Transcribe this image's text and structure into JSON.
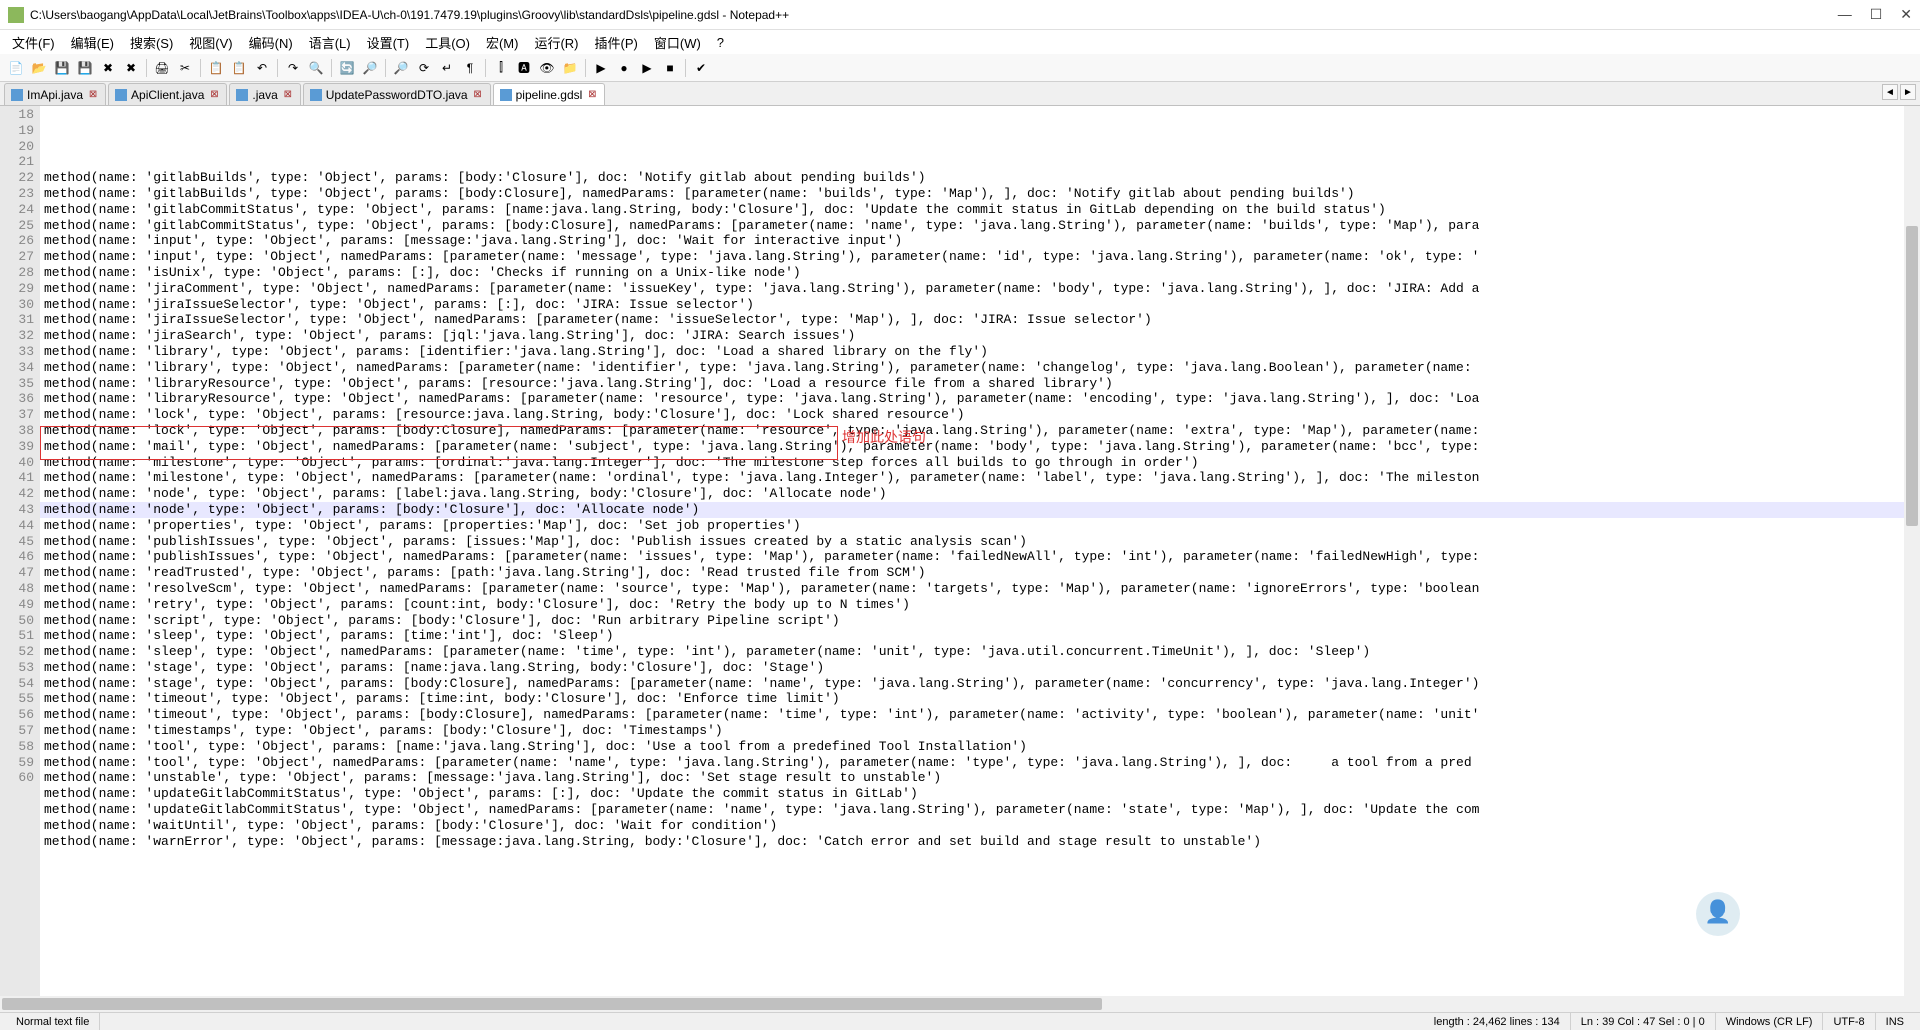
{
  "window": {
    "title": "C:\\Users\\baogang\\AppData\\Local\\JetBrains\\Toolbox\\apps\\IDEA-U\\ch-0\\191.7479.19\\plugins\\Groovy\\lib\\standardDsls\\pipeline.gdsl - Notepad++"
  },
  "menu": {
    "items": [
      "文件(F)",
      "编辑(E)",
      "搜索(S)",
      "视图(V)",
      "编码(N)",
      "语言(L)",
      "设置(T)",
      "工具(O)",
      "宏(M)",
      "运行(R)",
      "插件(P)",
      "窗口(W)",
      "?"
    ]
  },
  "toolbar": {
    "icons": [
      "new",
      "open",
      "save",
      "save-all",
      "close",
      "close-all",
      "print",
      "cut",
      "copy",
      "paste",
      "undo",
      "redo",
      "find",
      "replace",
      "zoom-in",
      "zoom-out",
      "sync",
      "wrap",
      "show-all",
      "indent-guide",
      "lang",
      "eye",
      "folder",
      "run",
      "rec",
      "play",
      "stop",
      "spellcheck"
    ]
  },
  "tabs": {
    "items": [
      {
        "label": "ImApi.java",
        "active": false
      },
      {
        "label": "ApiClient.java",
        "active": false
      },
      {
        "label": ".java",
        "active": false
      },
      {
        "label": "UpdatePasswordDTO.java",
        "active": false
      },
      {
        "label": "pipeline.gdsl",
        "active": true
      }
    ]
  },
  "editor": {
    "first_line": 18,
    "highlighted_line": 39,
    "lines": [
      "method(name: 'gitlabBuilds', type: 'Object', params: [body:'Closure'], doc: 'Notify gitlab about pending builds')",
      "method(name: 'gitlabBuilds', type: 'Object', params: [body:Closure], namedParams: [parameter(name: 'builds', type: 'Map'), ], doc: 'Notify gitlab about pending builds')",
      "method(name: 'gitlabCommitStatus', type: 'Object', params: [name:java.lang.String, body:'Closure'], doc: 'Update the commit status in GitLab depending on the build status')",
      "method(name: 'gitlabCommitStatus', type: 'Object', params: [body:Closure], namedParams: [parameter(name: 'name', type: 'java.lang.String'), parameter(name: 'builds', type: 'Map'), para",
      "method(name: 'input', type: 'Object', params: [message:'java.lang.String'], doc: 'Wait for interactive input')",
      "method(name: 'input', type: 'Object', namedParams: [parameter(name: 'message', type: 'java.lang.String'), parameter(name: 'id', type: 'java.lang.String'), parameter(name: 'ok', type: '",
      "method(name: 'isUnix', type: 'Object', params: [:], doc: 'Checks if running on a Unix-like node')",
      "method(name: 'jiraComment', type: 'Object', namedParams: [parameter(name: 'issueKey', type: 'java.lang.String'), parameter(name: 'body', type: 'java.lang.String'), ], doc: 'JIRA: Add a",
      "method(name: 'jiraIssueSelector', type: 'Object', params: [:], doc: 'JIRA: Issue selector')",
      "method(name: 'jiraIssueSelector', type: 'Object', namedParams: [parameter(name: 'issueSelector', type: 'Map'), ], doc: 'JIRA: Issue selector')",
      "method(name: 'jiraSearch', type: 'Object', params: [jql:'java.lang.String'], doc: 'JIRA: Search issues')",
      "method(name: 'library', type: 'Object', params: [identifier:'java.lang.String'], doc: 'Load a shared library on the fly')",
      "method(name: 'library', type: 'Object', namedParams: [parameter(name: 'identifier', type: 'java.lang.String'), parameter(name: 'changelog', type: 'java.lang.Boolean'), parameter(name:",
      "method(name: 'libraryResource', type: 'Object', params: [resource:'java.lang.String'], doc: 'Load a resource file from a shared library')",
      "method(name: 'libraryResource', type: 'Object', namedParams: [parameter(name: 'resource', type: 'java.lang.String'), parameter(name: 'encoding', type: 'java.lang.String'), ], doc: 'Loa",
      "method(name: 'lock', type: 'Object', params: [resource:java.lang.String, body:'Closure'], doc: 'Lock shared resource')",
      "method(name: 'lock', type: 'Object', params: [body:Closure], namedParams: [parameter(name: 'resource', type: 'java.lang.String'), parameter(name: 'extra', type: 'Map'), parameter(name:",
      "method(name: 'mail', type: 'Object', namedParams: [parameter(name: 'subject', type: 'java.lang.String'), parameter(name: 'body', type: 'java.lang.String'), parameter(name: 'bcc', type:",
      "method(name: 'milestone', type: 'Object', params: [ordinal:'java.lang.Integer'], doc: 'The milestone step forces all builds to go through in order')",
      "method(name: 'milestone', type: 'Object', namedParams: [parameter(name: 'ordinal', type: 'java.lang.Integer'), parameter(name: 'label', type: 'java.lang.String'), ], doc: 'The mileston",
      "method(name: 'node', type: 'Object', params: [label:java.lang.String, body:'Closure'], doc: 'Allocate node')",
      "method(name: 'node', type: 'Object', params: [body:'Closure'], doc: 'Allocate node')",
      "method(name: 'properties', type: 'Object', params: [properties:'Map'], doc: 'Set job properties')",
      "method(name: 'publishIssues', type: 'Object', params: [issues:'Map'], doc: 'Publish issues created by a static analysis scan')",
      "method(name: 'publishIssues', type: 'Object', namedParams: [parameter(name: 'issues', type: 'Map'), parameter(name: 'failedNewAll', type: 'int'), parameter(name: 'failedNewHigh', type:",
      "method(name: 'readTrusted', type: 'Object', params: [path:'java.lang.String'], doc: 'Read trusted file from SCM')",
      "method(name: 'resolveScm', type: 'Object', namedParams: [parameter(name: 'source', type: 'Map'), parameter(name: 'targets', type: 'Map'), parameter(name: 'ignoreErrors', type: 'boolean",
      "method(name: 'retry', type: 'Object', params: [count:int, body:'Closure'], doc: 'Retry the body up to N times')",
      "method(name: 'script', type: 'Object', params: [body:'Closure'], doc: 'Run arbitrary Pipeline script')",
      "method(name: 'sleep', type: 'Object', params: [time:'int'], doc: 'Sleep')",
      "method(name: 'sleep', type: 'Object', namedParams: [parameter(name: 'time', type: 'int'), parameter(name: 'unit', type: 'java.util.concurrent.TimeUnit'), ], doc: 'Sleep')",
      "method(name: 'stage', type: 'Object', params: [name:java.lang.String, body:'Closure'], doc: 'Stage')",
      "method(name: 'stage', type: 'Object', params: [body:Closure], namedParams: [parameter(name: 'name', type: 'java.lang.String'), parameter(name: 'concurrency', type: 'java.lang.Integer')",
      "method(name: 'timeout', type: 'Object', params: [time:int, body:'Closure'], doc: 'Enforce time limit')",
      "method(name: 'timeout', type: 'Object', params: [body:Closure], namedParams: [parameter(name: 'time', type: 'int'), parameter(name: 'activity', type: 'boolean'), parameter(name: 'unit'",
      "method(name: 'timestamps', type: 'Object', params: [body:'Closure'], doc: 'Timestamps')",
      "method(name: 'tool', type: 'Object', params: [name:'java.lang.String'], doc: 'Use a tool from a predefined Tool Installation')",
      "method(name: 'tool', type: 'Object', namedParams: [parameter(name: 'name', type: 'java.lang.String'), parameter(name: 'type', type: 'java.lang.String'), ], doc:     a tool from a pred",
      "method(name: 'unstable', type: 'Object', params: [message:'java.lang.String'], doc: 'Set stage result to unstable')",
      "method(name: 'updateGitlabCommitStatus', type: 'Object', params: [:], doc: 'Update the commit status in GitLab')",
      "method(name: 'updateGitlabCommitStatus', type: 'Object', namedParams: [parameter(name: 'name', type: 'java.lang.String'), parameter(name: 'state', type: 'Map'), ], doc: 'Update the com",
      "method(name: 'waitUntil', type: 'Object', params: [body:'Closure'], doc: 'Wait for condition')",
      "method(name: 'warnError', type: 'Object', params: [message:java.lang.String, body:'Closure'], doc: 'Catch error and set build and stage result to unstable')"
    ]
  },
  "annotation": {
    "text": "增加此处语句"
  },
  "status": {
    "left": "Normal text file",
    "length": "length : 24,462    lines : 134",
    "pos": "Ln : 39   Col : 47   Sel : 0 | 0",
    "eol": "Windows (CR LF)",
    "enc": "UTF-8",
    "ins": "INS"
  }
}
